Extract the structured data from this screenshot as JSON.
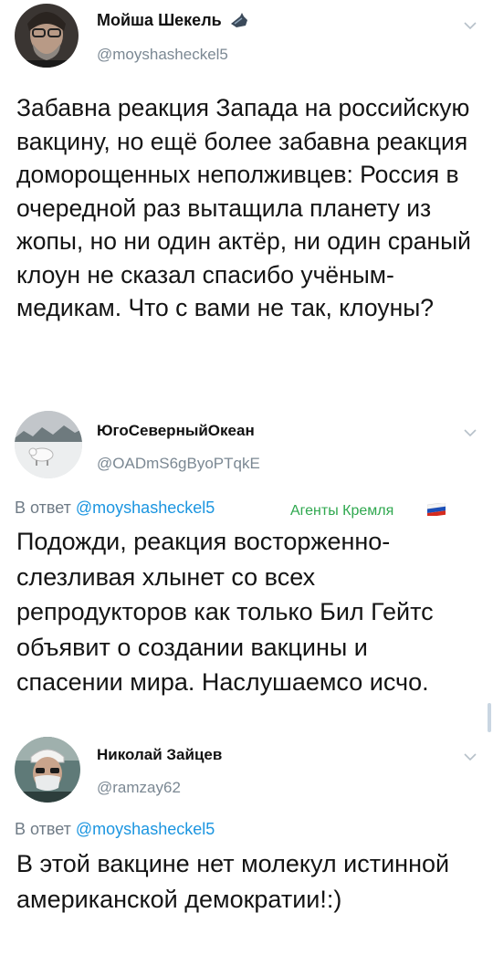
{
  "tweets": [
    {
      "author": {
        "name": "Мойша Шекель",
        "handle": "@moyshasheckel5"
      },
      "text": "Забавна реакция Запада на российскую вакцину, но ещё более забавна реакция доморощенных неполживцев: Россия в очередной раз вытащила планету из жопы, но ни один актёр, ни один сраный клоун не сказал спасибо учёным-медикам. Что с вами не так, клоуны?"
    },
    {
      "author": {
        "name": "ЮгоСеверныйОкеан",
        "handle": "@OADmS6gByoPTqkE"
      },
      "reply_prefix": "В ответ ",
      "reply_mention": "@moyshasheckel5",
      "badge": "Агенты Кремля",
      "text": "Подожди, реакция восторженно-слезливая хлынет со всех репродукторов как только Бил Гейтс объявит о создании вакцины и спасении мира. Наслушаемсо исчо."
    },
    {
      "author": {
        "name": "Николай Зайцев",
        "handle": "@ramzay62"
      },
      "reply_prefix": "В ответ ",
      "reply_mention": "@moyshasheckel5",
      "text": "В этой вакцине нет молекул истинной американской демократии!:)"
    }
  ],
  "colors": {
    "mention": "#1b95e0",
    "badge": "#2fa84f",
    "muted": "#7b8893"
  },
  "icons": [
    "chevron-down-icon",
    "hand-emoji-icon",
    "russia-flag-icon"
  ]
}
